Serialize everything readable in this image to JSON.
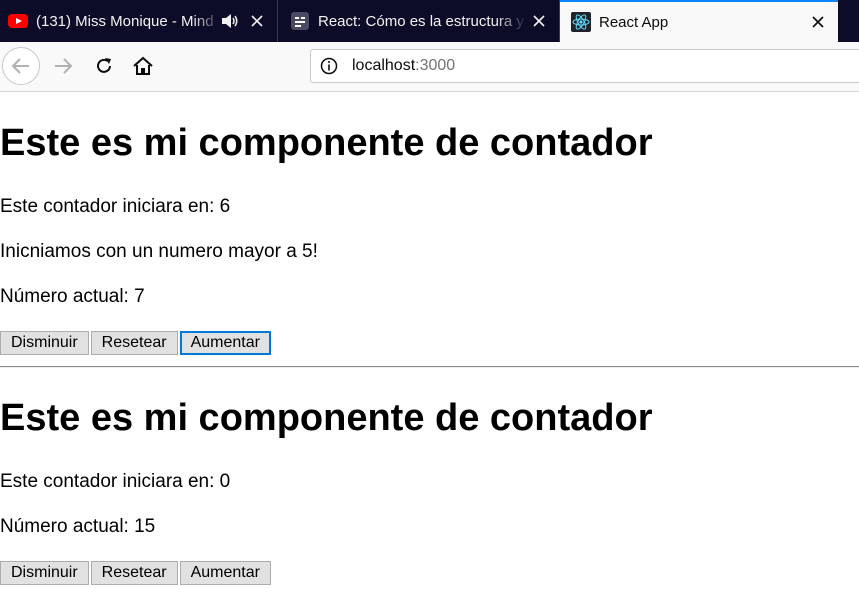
{
  "browser": {
    "tabs": [
      {
        "title": "(131) Miss Monique - Mind",
        "favicon": "youtube-icon",
        "audio": "speaker-icon"
      },
      {
        "title": "React: Cómo es la estructura y f",
        "favicon": "page-icon"
      },
      {
        "title": "React App",
        "favicon": "react-icon"
      }
    ],
    "url": {
      "host": "localhost",
      "port": ":3000"
    }
  },
  "colors": {
    "tab_strip_bg": "#0c0c29",
    "active_tab_accent": "#0a84ff",
    "focus_ring": "#0078d7",
    "youtube_red": "#ff0000",
    "react_cyan": "#61dafb"
  },
  "counters": [
    {
      "heading": "Este es mi componente de contador",
      "initial_text": "Este contador iniciara en: 6",
      "message": "Inicniamos con un numero mayor a 5!",
      "current_text": "Número actual: 7",
      "buttons": {
        "decrement": "Disminuir",
        "reset": "Resetear",
        "increment": "Aumentar"
      }
    },
    {
      "heading": "Este es mi componente de contador",
      "initial_text": "Este contador iniciara en: 0",
      "current_text": "Número actual: 15",
      "buttons": {
        "decrement": "Disminuir",
        "reset": "Resetear",
        "increment": "Aumentar"
      }
    }
  ]
}
